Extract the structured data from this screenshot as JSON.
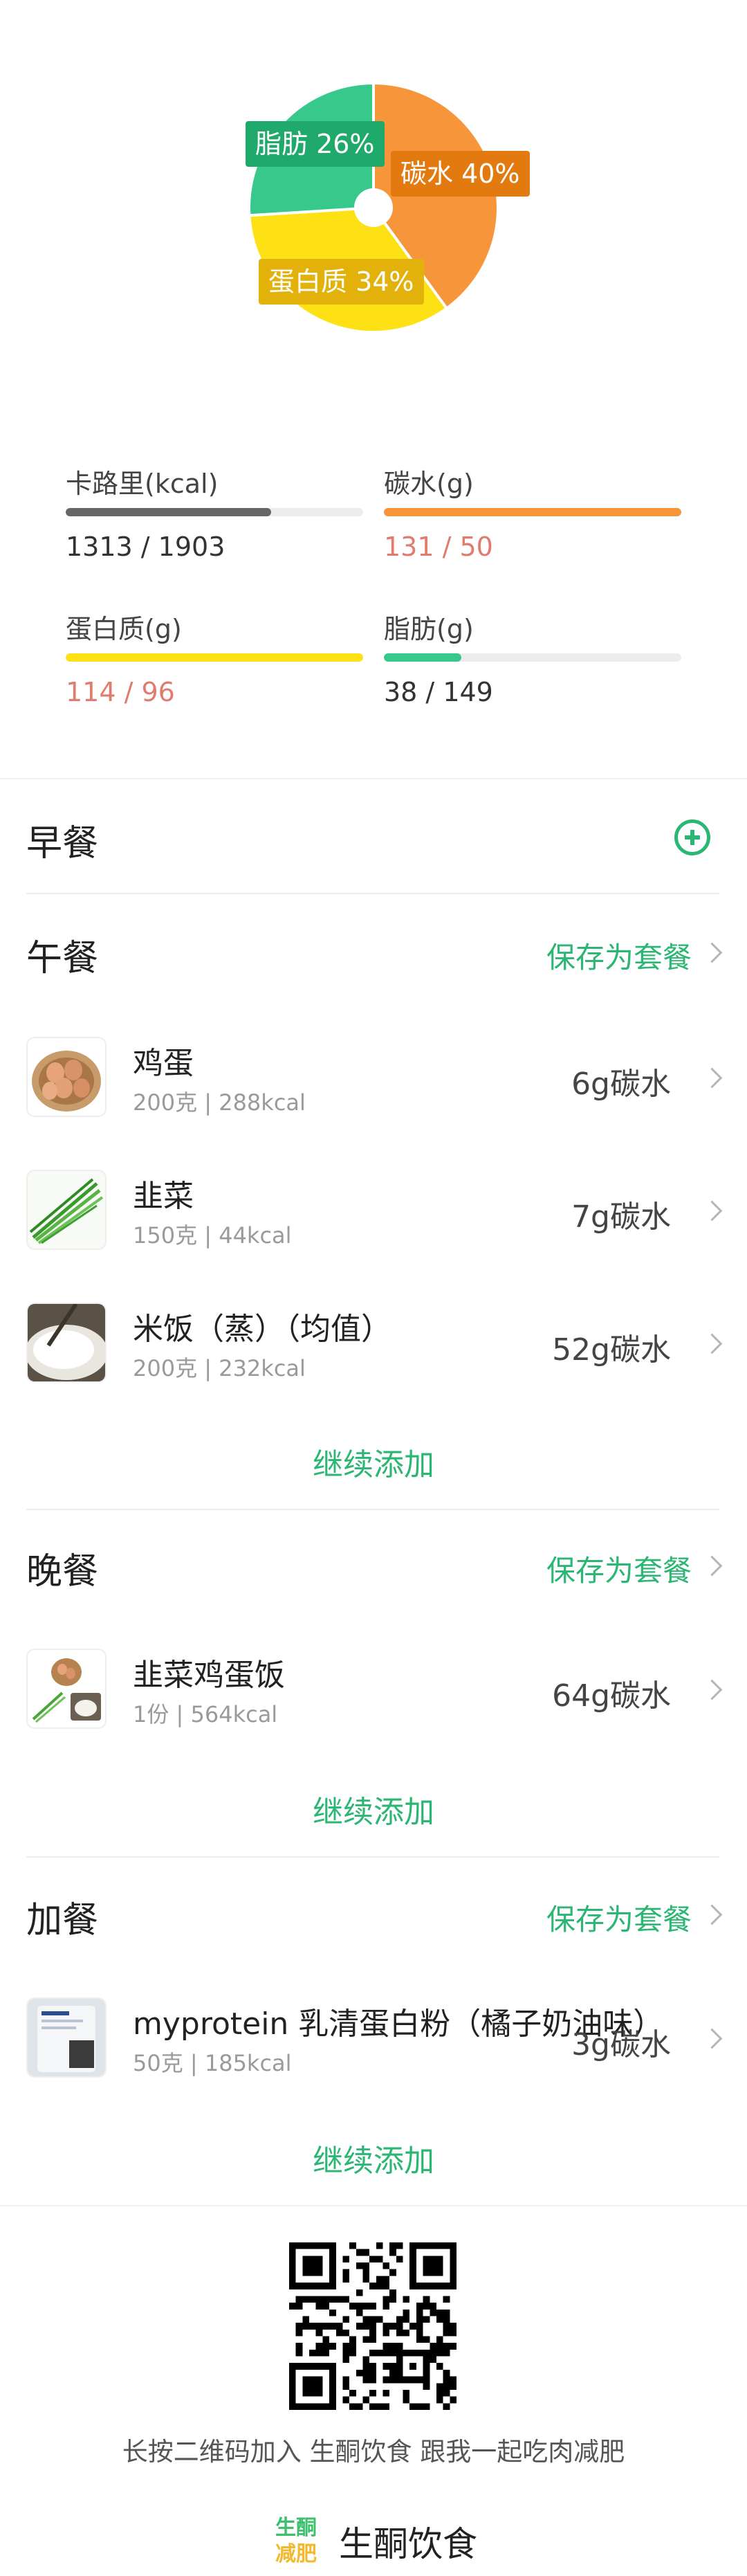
{
  "macro_pie": {
    "slices": [
      {
        "name": "碳水",
        "percent": 40,
        "color": "#f7953a"
      },
      {
        "name": "蛋白质",
        "percent": 34,
        "color": "#fde114"
      },
      {
        "name": "脂肪",
        "percent": 26,
        "color": "#37c98c"
      }
    ],
    "labels": {
      "fat": "脂肪 26%",
      "carb": "碳水 40%",
      "protein": "蛋白质 34%"
    }
  },
  "stats": {
    "calories": {
      "label": "卡路里(kcal)",
      "value": "1313 / 1903",
      "progress": 0.69,
      "color": "#666666",
      "over": false
    },
    "carb": {
      "label": "碳水(g)",
      "value": "131 / 50",
      "progress": 1.0,
      "color": "#f7953a",
      "over": true
    },
    "protein": {
      "label": "蛋白质(g)",
      "value": "114 / 96",
      "progress": 1.0,
      "color": "#fde114",
      "over": true
    },
    "fat": {
      "label": "脂肪(g)",
      "value": "38 / 149",
      "progress": 0.26,
      "color": "#37c98c",
      "over": false
    }
  },
  "meals": {
    "breakfast": {
      "title": "早餐"
    },
    "lunch": {
      "title": "午餐",
      "save_label": "保存为套餐",
      "items": [
        {
          "name": "鸡蛋",
          "meta": "200克 | 288kcal",
          "carb": "6g碳水"
        },
        {
          "name": "韭菜",
          "meta": "150克 | 44kcal",
          "carb": "7g碳水"
        },
        {
          "name": "米饭（蒸）（均值）",
          "meta": "200克 | 232kcal",
          "carb": "52g碳水"
        }
      ],
      "continue_label": "继续添加"
    },
    "dinner": {
      "title": "晚餐",
      "save_label": "保存为套餐",
      "items": [
        {
          "name": "韭菜鸡蛋饭",
          "meta": "1份 | 564kcal",
          "carb": "64g碳水"
        }
      ],
      "continue_label": "继续添加"
    },
    "snack": {
      "title": "加餐",
      "save_label": "保存为套餐",
      "items": [
        {
          "name": "myprotein 乳清蛋白粉（橘子奶油味）",
          "meta": "50克 | 185kcal",
          "carb": "3g碳水"
        }
      ],
      "continue_label": "继续添加"
    }
  },
  "footer": {
    "qr_caption": "长按二维码加入 生酮饮食 跟我一起吃肉减肥",
    "brand_logo_text": "生酮减肥",
    "brand_name": "生酮饮食"
  },
  "colors": {
    "accent": "#2bb673",
    "over": "#e07b6e"
  }
}
